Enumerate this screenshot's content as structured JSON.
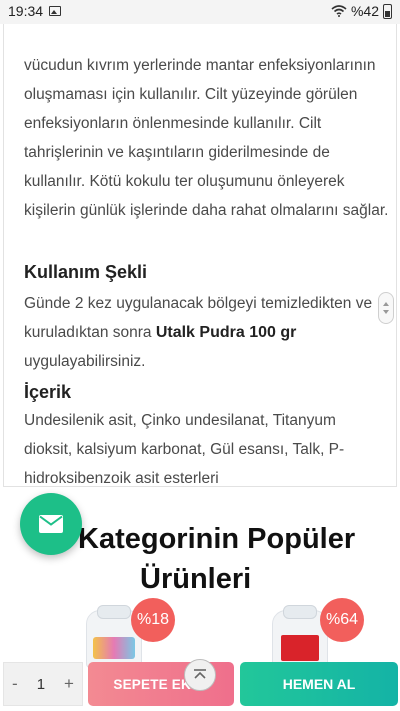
{
  "status_bar": {
    "time": "19:34",
    "battery": "%42",
    "icons": [
      "image-icon",
      "wifi-icon",
      "battery-icon"
    ]
  },
  "description": {
    "text": "vücudun kıvrım yerlerinde mantar enfeksiyonlarının oluşmaması için kullanılır. Cilt yüzeyinde görülen enfeksiyonların önlenmesinde kullanılır. Cilt tahrişlerinin ve kaşıntıların giderilmesinde de kullanılır. Kötü kokulu ter oluşumunu önleyerek kişilerin günlük işlerinde daha rahat olmalarını sağlar."
  },
  "usage": {
    "heading": "Kullanım Şekli",
    "text_before": "Günde 2 kez uygulanacak bölgeyi temizledikten ve kuruladıktan sonra ",
    "product_name": "Utalk Pudra 100 gr",
    "text_after": " uygulayabilirsiniz."
  },
  "ingredients": {
    "heading": "İçerik",
    "text": "Undesilenik asit, Çinko undesilanat, Titanyum dioksit, kalsiyum karbonat, Gül esansı, Talk, P-hidroksibenzoik asit esterleri"
  },
  "popular": {
    "title_line1": "Kategorinin Popüler",
    "title_line2": "Ürünleri",
    "products": [
      {
        "discount": "%18"
      },
      {
        "discount": "%64"
      }
    ]
  },
  "actions": {
    "quantity": "1",
    "minus": "-",
    "plus": "+",
    "add_to_cart": "SEPETE EKLE",
    "buy_now": "HEMEN AL"
  },
  "colors": {
    "mail_fab": "#1dbf88",
    "discount_badge": "#f25f5c",
    "cart_button": "#ef6f8c",
    "buy_button": "#14b3a6"
  }
}
